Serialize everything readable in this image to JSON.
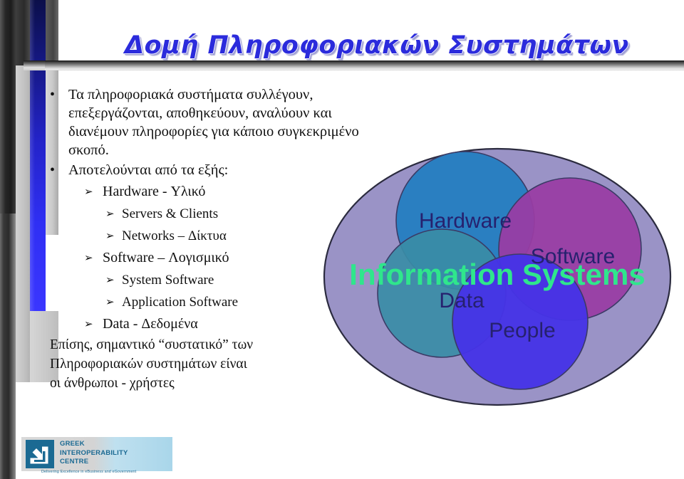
{
  "slide": {
    "title": "Δομή Πληροφοριακών Συστημάτων",
    "title_color": "#2b2bdc"
  },
  "content": {
    "bullet_glyph": "•",
    "arrow_glyph": "➢",
    "bullets": [
      {
        "level": 1,
        "line1": "Τα πληροφοριακά συστήματα συλλέγουν, επεξεργάζονται, αποθηκεύουν, αναλύουν",
        "line2": "και διανέμουν πληροφορίες για κάποιο συγκεκριμένο σκοπό."
      },
      {
        "level": 1,
        "line1": "Αποτελούνται από τα εξής:"
      },
      {
        "level": 2,
        "line1": "Hardware - Υλικό"
      },
      {
        "level": 3,
        "line1": "Servers & Clients"
      },
      {
        "level": 3,
        "line1": "Networks – Δίκτυα"
      },
      {
        "level": 2,
        "line1": "Software – Λογισμικό"
      },
      {
        "level": 3,
        "line1": "System Software"
      },
      {
        "level": 3,
        "line1": "Application Software"
      },
      {
        "level": 2,
        "line1": "Data - Δεδομένα"
      }
    ],
    "closing": {
      "line1": "Επίσης, σημαντικό “συστατικό” των",
      "line2": "Πληροφοριακών συστημάτων είναι",
      "line3": "οι άνθρωποι - χρήστες"
    }
  },
  "diagram": {
    "type": "venn",
    "outer_label": "Information Systems",
    "outer_label_color": "#2fe68c",
    "outer_fill": "#9a93c6",
    "outer_stroke": "#2b2b3f",
    "label_color": "#26216e",
    "circles": [
      {
        "name": "Hardware",
        "label": "Hardware",
        "fill": "#2a7fc1"
      },
      {
        "name": "Software",
        "label": "Software",
        "fill": "#993da4"
      },
      {
        "name": "Data",
        "label": "Data",
        "fill": "#3a8ca6"
      },
      {
        "name": "People",
        "label": "People",
        "fill": "#4633e6"
      }
    ]
  },
  "logo": {
    "line1": "GREEK",
    "line2": "INTEROPERABILITY",
    "line3": "CENTRE",
    "tagline": "Delivering Excellence in eBusiness and eGovernment",
    "mark_color": "#1b6a93"
  }
}
